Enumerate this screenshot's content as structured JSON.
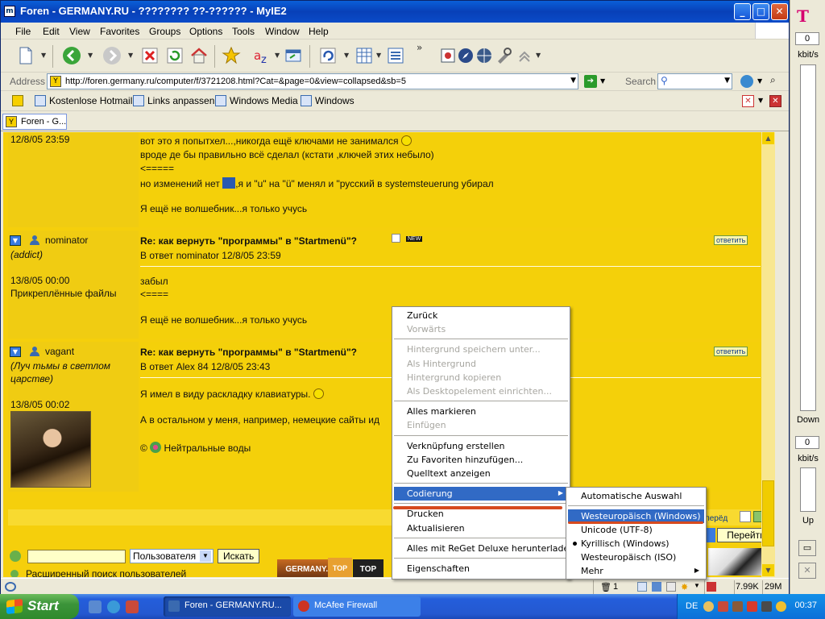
{
  "window": {
    "title": "Foren - GERMANY.RU - ???????? ??-?????? - MyIE2",
    "app_icon": "m",
    "buttons": {
      "minimize": "_",
      "maximize": "□",
      "close": "✕"
    }
  },
  "menubar": {
    "items": [
      "File",
      "Edit",
      "View",
      "Favorites",
      "Groups",
      "Options",
      "Tools",
      "Window",
      "Help"
    ]
  },
  "toolbar": {
    "more": "»",
    "icons": [
      "new-page-icon",
      "back-icon",
      "forward-icon",
      "stop-icon",
      "refresh-icon",
      "home-icon",
      "favorites-star-icon",
      "translate-icon",
      "window-icon",
      "undo-icon",
      "grid-icon",
      "list-icon",
      "quick-icon",
      "compass-icon",
      "globe-icon",
      "tools-icon",
      "collapse-icon"
    ]
  },
  "addressbar": {
    "label": "Address",
    "url": "http://foren.germany.ru/computer/f/3721208.html?Cat=&page=0&view=collapsed&sb=5",
    "search_label": "Search",
    "go_icon": "go-arrow-icon"
  },
  "linksbar": {
    "items": [
      "Kostenlose Hotmail",
      "Links anpassen",
      "Windows Media",
      "Windows"
    ]
  },
  "tabs": [
    {
      "label": "Foren - G...",
      "active": true
    }
  ],
  "posts": [
    {
      "date": "12/8/05 23:59",
      "lines": [
        "вот это я попытхел...,никогда ещё ключами не занимался",
        "вроде де бы правильно всё сделал (кстати ,ключей этих небыло)",
        "<=====",
        "но изменений нет",
        ",я и \"u\" на \"ü\" менял и \"русский в systemsteuerung убирал",
        "Я ещё не волшебник...я только учусь"
      ]
    },
    {
      "author": "nominator",
      "rank": "(addict)",
      "date": "13/8/05 00:00",
      "attachments": "Прикреплённые файлы",
      "title": "Re: как вернуть \"программы\" в \"Startmenü\"?",
      "new_badge": "NEW",
      "reply_to": "В ответ nominator 12/8/05 23:59",
      "reply_button": "ответить",
      "lines": [
        "забыл",
        "<====",
        "Я ещё не волшебник...я только учусь"
      ]
    },
    {
      "author": "vagant",
      "rank_line1": "(Луч тьмы в светлом",
      "rank_line2": "царстве)",
      "date": "13/8/05 00:02",
      "title": "Re: как вернуть \"программы\" в \"Startmenü\"?",
      "reply_to": "В ответ Alex 84 12/8/05 23:43",
      "reply_button": "ответить",
      "lines": [
        "Я имел в виду раскладку клавиатуры.",
        "А в остальном у меня, например, немецкие сайты ид",
        "Нейтральные воды"
      ],
      "copyright": "©"
    }
  ],
  "forum_footer": {
    "nav_next": "вперёд",
    "goto_button": "Перейти",
    "user_select": "Пользователя",
    "search_button": "Искать",
    "advanced_search": "Расширенный поиск пользователей",
    "banner1": "GERMANY.RU",
    "banner2": "TOP",
    "banner3": "TOP"
  },
  "context_menu": {
    "items": [
      {
        "label": "Zurück",
        "enabled": true
      },
      {
        "label": "Vorwärts",
        "enabled": false
      },
      {
        "sep": true
      },
      {
        "label": "Hintergrund speichern unter...",
        "enabled": false
      },
      {
        "label": "Als Hintergrund",
        "enabled": false
      },
      {
        "label": "Hintergrund kopieren",
        "enabled": false
      },
      {
        "label": "Als Desktopelement einrichten...",
        "enabled": false
      },
      {
        "sep": true
      },
      {
        "label": "Alles markieren",
        "enabled": true
      },
      {
        "label": "Einfügen",
        "enabled": false
      },
      {
        "sep": true
      },
      {
        "label": "Verknüpfung erstellen",
        "enabled": true
      },
      {
        "label": "Zu Favoriten hinzufügen...",
        "enabled": true
      },
      {
        "label": "Quelltext anzeigen",
        "enabled": true
      },
      {
        "sep": true
      },
      {
        "label": "Codierung",
        "enabled": true,
        "selected": true,
        "submenu": true
      },
      {
        "sep": true
      },
      {
        "label": "Drucken",
        "enabled": true
      },
      {
        "label": "Aktualisieren",
        "enabled": true
      },
      {
        "sep": true
      },
      {
        "label": "Alles mit ReGet Deluxe herunterladen",
        "enabled": true
      },
      {
        "sep": true
      },
      {
        "label": "Eigenschaften",
        "enabled": true
      }
    ]
  },
  "encoding_submenu": {
    "items": [
      {
        "label": "Automatische Auswahl"
      },
      {
        "sep": true
      },
      {
        "label": "Westeuropäisch (Windows)",
        "selected": true
      },
      {
        "label": "Unicode (UTF-8)"
      },
      {
        "label": "Kyrillisch (Windows)",
        "checked": true
      },
      {
        "label": "Westeuropäisch (ISO)"
      },
      {
        "label": "Mehr",
        "submenu": true
      }
    ]
  },
  "statusbar": {
    "page_count": "1",
    "size": "7.99K",
    "memory": "29M"
  },
  "meter": {
    "logo": "T",
    "down_value": "0",
    "down_unit": "kbit/s",
    "down_label": "Down",
    "up_value": "0",
    "up_unit": "kbit/s",
    "up_label": "Up"
  },
  "taskbar": {
    "start": "Start",
    "tasks": [
      {
        "label": "Foren - GERMANY.RU...",
        "active": true
      },
      {
        "label": "McAfee Firewall",
        "active": false
      }
    ],
    "tray": {
      "lang": "DE",
      "clock": "00:37"
    }
  },
  "colors": {
    "forum_bg": "#f5cf0c",
    "menu_highlight": "#316ac5",
    "red_annotation": "#d64a1e",
    "titlebar": "#0a5fd8"
  }
}
